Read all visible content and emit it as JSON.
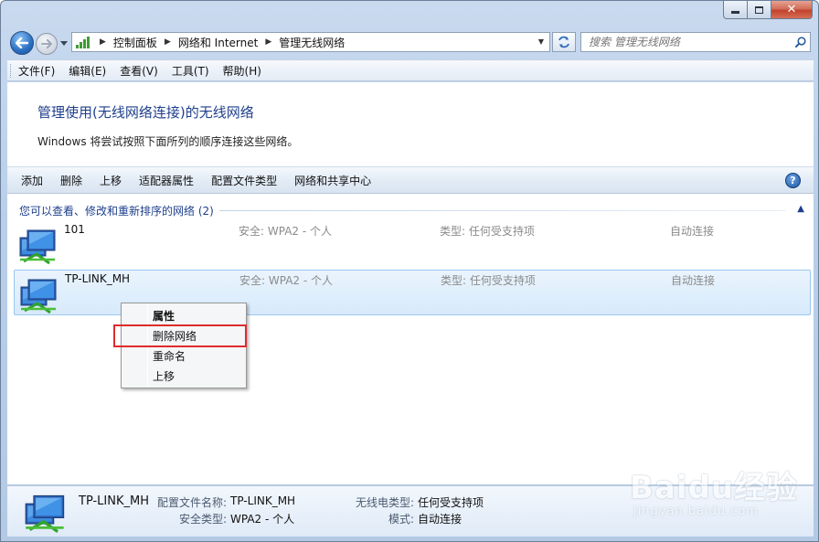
{
  "address": {
    "crumbs": [
      "控制面板",
      "网络和 Internet",
      "管理无线网络"
    ]
  },
  "search": {
    "placeholder": "搜索 管理无线网络"
  },
  "menu": [
    "文件(F)",
    "编辑(E)",
    "查看(V)",
    "工具(T)",
    "帮助(H)"
  ],
  "page": {
    "title": "管理使用(无线网络连接)的无线网络",
    "description": "Windows 将尝试按照下面所列的顺序连接这些网络。"
  },
  "commands": [
    "添加",
    "删除",
    "上移",
    "适配器属性",
    "配置文件类型",
    "网络和共享中心"
  ],
  "group": {
    "title": "您可以查看、修改和重新排序的网络 (2)"
  },
  "networks": [
    {
      "ssid": "101",
      "security": "安全: WPA2 - 个人",
      "type": "类型: 任何受支持项",
      "mode": "自动连接"
    },
    {
      "ssid": "TP-LINK_MH",
      "security": "安全: WPA2 - 个人",
      "type": "类型: 任何受支持项",
      "mode": "自动连接"
    }
  ],
  "context_menu": [
    "属性",
    "删除网络",
    "重命名",
    "上移"
  ],
  "details": {
    "name": "TP-LINK_MH",
    "profile_label": "配置文件名称:",
    "profile_value": "TP-LINK_MH",
    "radio_label": "无线电类型:",
    "radio_value": "任何受支持项",
    "security_label": "安全类型:",
    "security_value": "WPA2 - 个人",
    "mode_label": "模式:",
    "mode_value": "自动连接"
  },
  "watermark": {
    "brand": "Baidu经验",
    "url": "jingyan.baidu.com"
  },
  "colors": {
    "accent": "#1e3f8c",
    "highlight_box": "#e02b2b",
    "selection": "#d7eafb"
  }
}
